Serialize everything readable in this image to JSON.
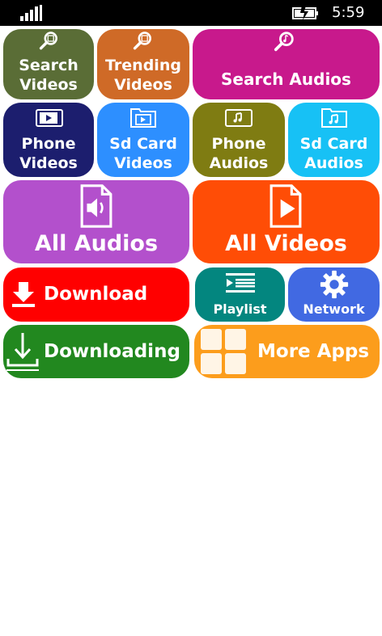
{
  "status_bar": {
    "time": "5:59",
    "icons": [
      "signal-icon",
      "battery-charging-icon"
    ]
  },
  "tiles": {
    "search_videos": {
      "line1": "Search",
      "line2": "Videos",
      "color": "#5a6d36",
      "icon": "search-video-icon"
    },
    "trending_videos": {
      "line1": "Trending",
      "line2": "Videos",
      "color": "#cf6a27",
      "icon": "search-video-icon"
    },
    "search_audios": {
      "label": "Search Audios",
      "color": "#c8198c",
      "icon": "search-music-icon"
    },
    "phone_videos": {
      "line1": "Phone",
      "line2": "Videos",
      "color": "#1c1e6e",
      "icon": "phone-video-icon"
    },
    "sd_card_videos": {
      "line1": "Sd Card",
      "line2": "Videos",
      "color": "#2d8fff",
      "icon": "folder-video-icon"
    },
    "phone_audios": {
      "line1": "Phone",
      "line2": "Audios",
      "color": "#7f7c12",
      "icon": "phone-music-icon"
    },
    "sd_card_audios": {
      "line1": "Sd Card",
      "line2": "Audios",
      "color": "#17c1f5",
      "icon": "folder-music-icon"
    },
    "all_audios": {
      "label": "All Audios",
      "color": "#b350cc",
      "icon": "audio-file-icon"
    },
    "all_videos": {
      "label": "All Videos",
      "color": "#ff4d06",
      "icon": "video-file-icon"
    },
    "download": {
      "label": "Download",
      "color": "#ff0000",
      "icon": "download-icon"
    },
    "playlist": {
      "label": "Playlist",
      "color": "#03867f",
      "icon": "playlist-icon"
    },
    "network": {
      "label": "Network",
      "color": "#4169e2",
      "icon": "gear-icon"
    },
    "downloading": {
      "label": "Downloading",
      "color": "#22881f",
      "icon": "downloading-icon"
    },
    "more_apps": {
      "label": "More Apps",
      "color": "#fc9d1c",
      "icon": "grid-icon"
    }
  }
}
